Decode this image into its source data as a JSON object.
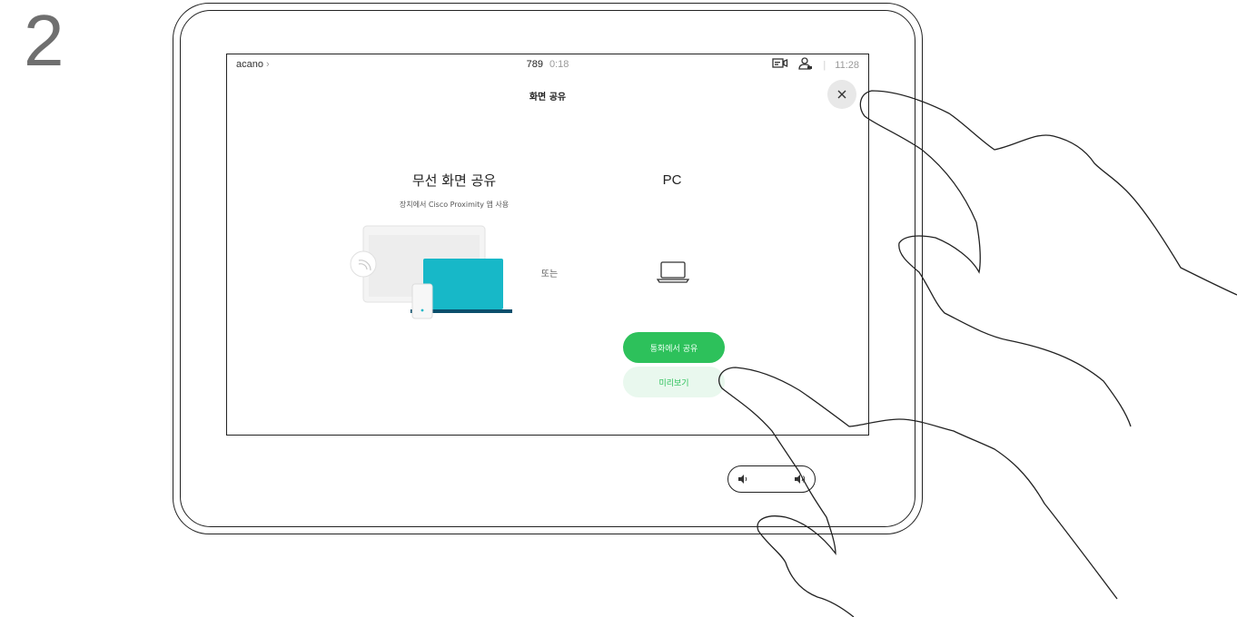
{
  "step_number": "2",
  "status_bar": {
    "left_label": "acano",
    "left_chevron": "›",
    "call_number": "789",
    "call_time": "0:18",
    "separator": "|",
    "clock": "11:28",
    "icons": [
      "self-view-icon",
      "participants-icon"
    ]
  },
  "dialog": {
    "title": "화면 공유",
    "close_icon": "close-icon"
  },
  "wireless": {
    "title": "무선 화면 공유",
    "subtitle": "장치에서 Cisco Proximity 앱 사용"
  },
  "or_text": "또는",
  "pc": {
    "title": "PC",
    "share_button": "통화에서 공유",
    "preview_button": "미리보기"
  },
  "volume": {
    "down_icon": "volume-down-icon",
    "up_icon": "volume-up-icon"
  },
  "colors": {
    "accent_green": "#2dc15b",
    "light_green": "#e9f8ee",
    "laptop_teal": "#17b8c8",
    "laptop_base": "#0b4f6c"
  }
}
